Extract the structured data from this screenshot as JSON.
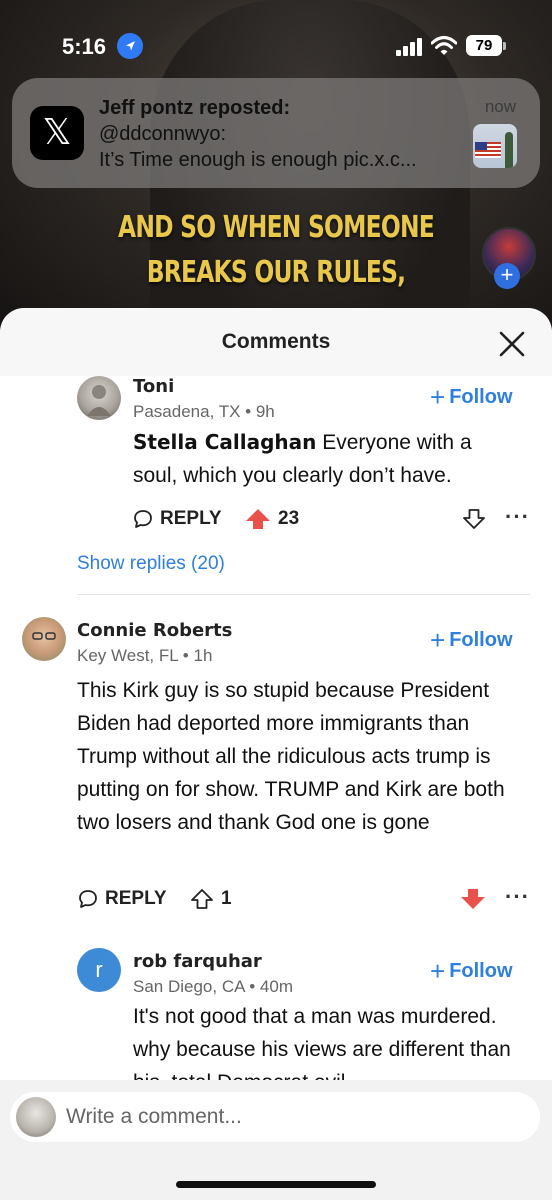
{
  "status_bar": {
    "time": "5:16",
    "battery": "79"
  },
  "video": {
    "caption_line1": "AND SO WHEN SOMEONE",
    "caption_line2": "BREAKS OUR RULES,"
  },
  "notification": {
    "app_icon": "x-logo-icon",
    "title": "Jeff pontz reposted:",
    "line1": "@ddconnwyo:",
    "line2": "It’s Time enough is enough pic.x.c...",
    "time": "now"
  },
  "sheet": {
    "title": "Comments"
  },
  "comments": [
    {
      "name": "Toni",
      "meta": "Pasadena, TX • 9h",
      "follow": "Follow",
      "mention": "Stella Callaghan",
      "text": " Everyone with a soul, which you clearly don’t have.",
      "reply": "REPLY",
      "votes": "23",
      "vote_state": "upvoted",
      "show_replies": "Show replies (20)"
    },
    {
      "name": "Connie Roberts",
      "meta": "Key West, FL • 1h",
      "follow": "Follow",
      "text": "This Kirk guy is so stupid because President Biden had deported more immigrants than Trump without all the ridiculous acts trump is putting on for show. TRUMP and Kirk are both two losers and thank God one is gone",
      "reply": "REPLY",
      "votes": "1",
      "vote_state": "downvoted"
    },
    {
      "name": "rob farquhar",
      "initial": "r",
      "meta": "San Diego, CA • 40m",
      "follow": "Follow",
      "text": "It's not good that a man was murdered. why because his views are different than his. total Democrat evil"
    }
  ],
  "compose": {
    "placeholder": "Write a comment..."
  },
  "colors": {
    "accent": "#2f7fdc",
    "upvote": "#e8524a",
    "downvote": "#e8524a",
    "caption": "#e8c74a"
  }
}
